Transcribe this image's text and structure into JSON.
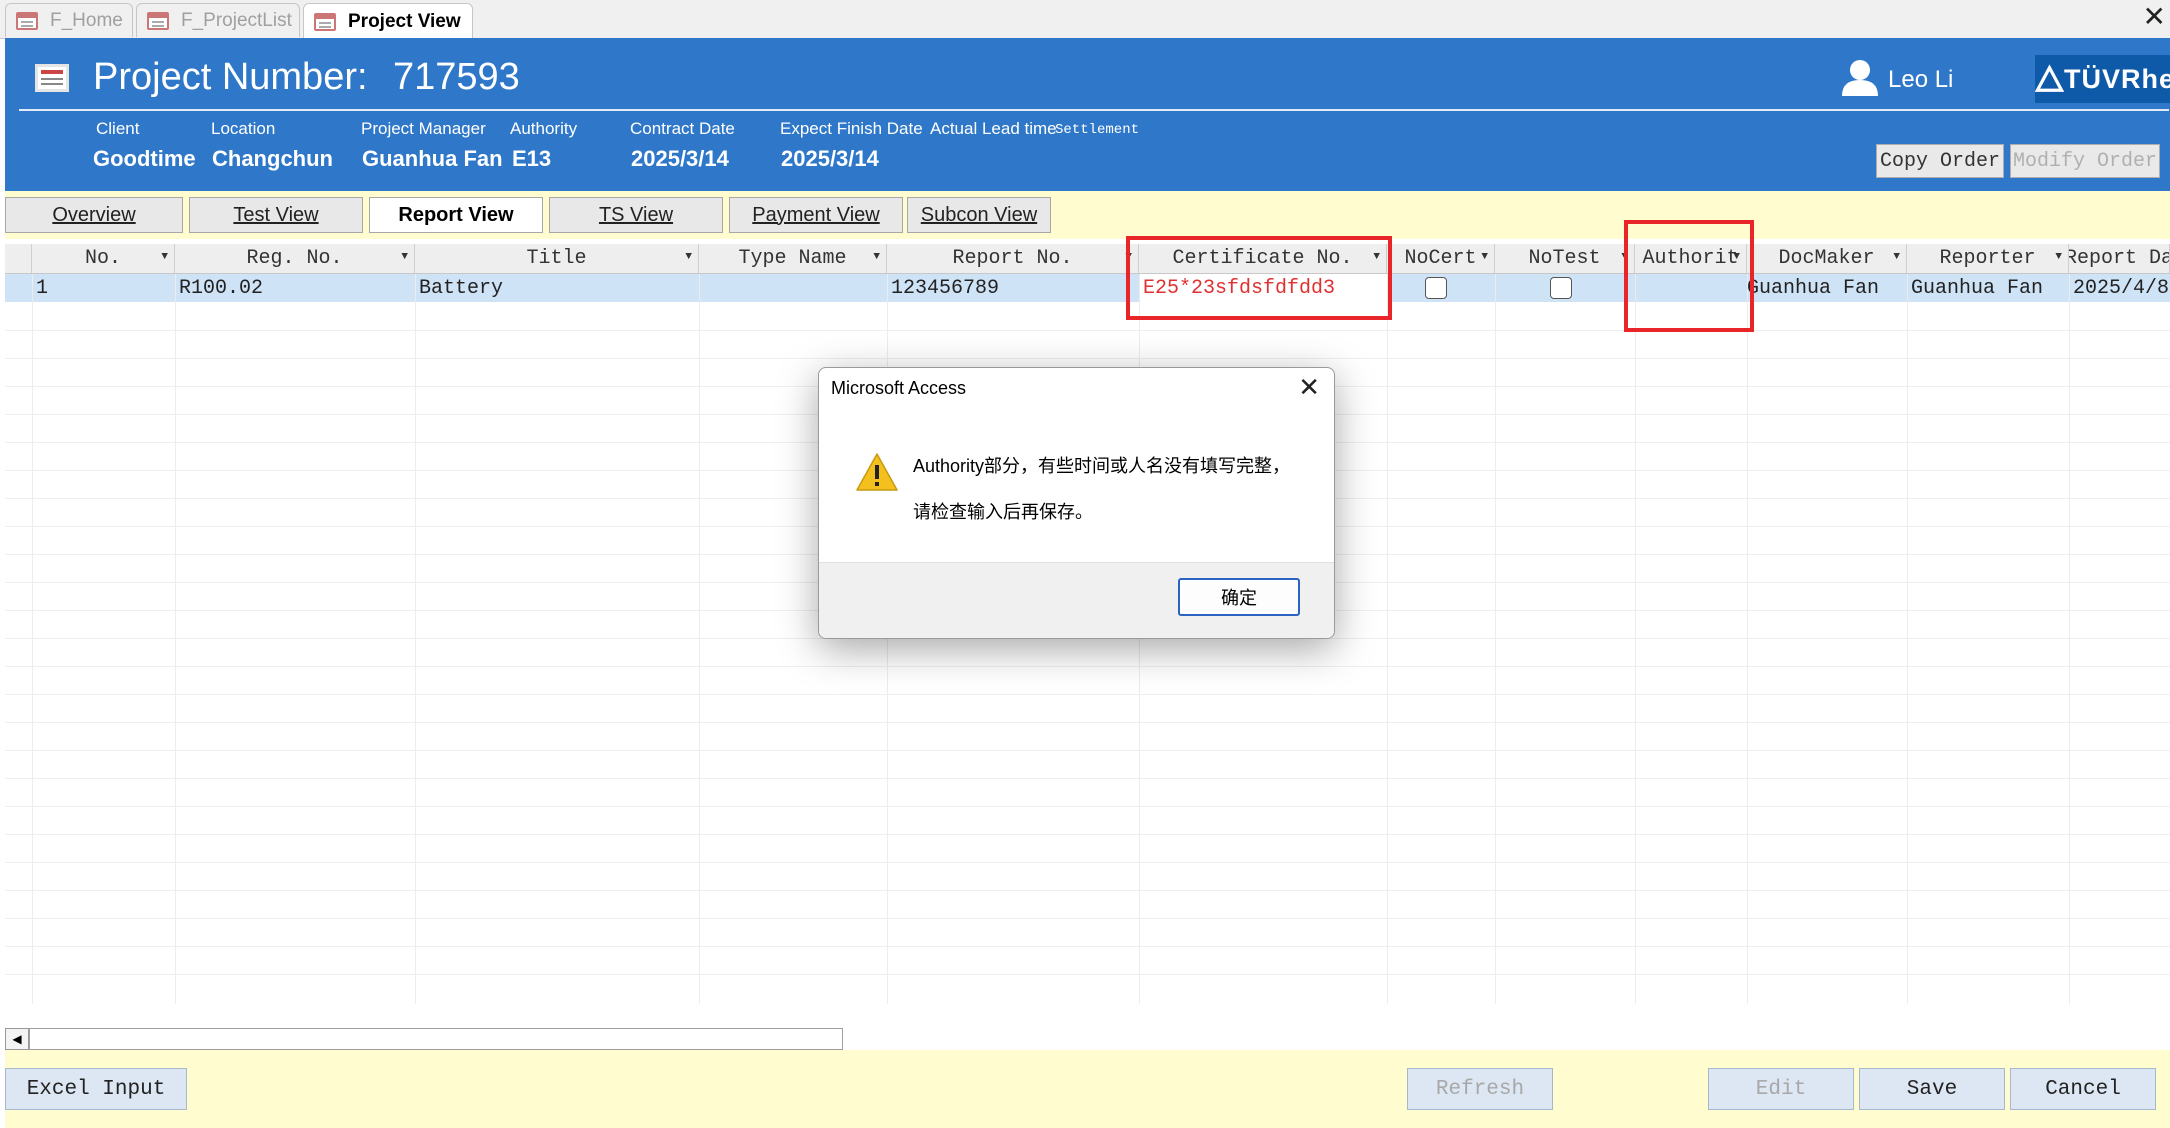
{
  "doc_tabs": [
    {
      "label": "F_Home",
      "active": false
    },
    {
      "label": "F_ProjectList",
      "active": false
    },
    {
      "label": "Project View",
      "active": true
    }
  ],
  "header": {
    "project_label": "Project Number:",
    "project_number": "717593",
    "user_name": "Leo Li",
    "logo_text": "TÜVRhe",
    "fields": [
      {
        "label": "Client",
        "value": "Goodtime"
      },
      {
        "label": "Location",
        "value": "Changchun"
      },
      {
        "label": "Project Manager",
        "value": "Guanhua Fan"
      },
      {
        "label": "Authority",
        "value": "E13"
      },
      {
        "label": "Contract Date",
        "value": "2025/3/14"
      },
      {
        "label": "Expect Finish Date",
        "value": "2025/3/14"
      },
      {
        "label": "Actual Lead time",
        "value": ""
      },
      {
        "label": "Settlement",
        "value": ""
      }
    ],
    "copy_order": "Copy Order",
    "modify_order": "Modify Order"
  },
  "view_tabs": [
    {
      "label": "Overview",
      "active": false
    },
    {
      "label": "Test View",
      "active": false
    },
    {
      "label": "Report View",
      "active": true
    },
    {
      "label": "TS View",
      "active": false
    },
    {
      "label": "Payment View",
      "active": false
    },
    {
      "label": "Subcon View",
      "active": false
    }
  ],
  "grid": {
    "columns": [
      "No.",
      "Reg. No.",
      "Title",
      "Type Name",
      "Report No.",
      "Certificate No.",
      "NoCert",
      "NoTest",
      "Authorit",
      "DocMaker",
      "Reporter",
      "Report Da"
    ],
    "rows": [
      {
        "no": "1",
        "reg_no": "R100.02",
        "title": "Battery",
        "type_name": "",
        "report_no": "123456789",
        "certificate_no": "E25*23sfdsfdfdd3",
        "no_cert": false,
        "no_test": false,
        "authority": "",
        "doc_maker": "Guanhua Fan",
        "reporter": "Guanhua Fan",
        "report_date": "2025/4/8"
      }
    ]
  },
  "footer": {
    "excel_input": "Excel Input",
    "refresh": "Refresh",
    "edit": "Edit",
    "save": "Save",
    "cancel": "Cancel"
  },
  "dialog": {
    "title": "Microsoft Access",
    "message_line1": "Authority部分，有些时间或人名没有填写完整，",
    "message_line2": "请检查输入后再保存。",
    "ok": "确定"
  },
  "colors": {
    "header_blue": "#2f78c9",
    "band_yellow": "#fffdd0",
    "highlight_red": "#e8262a",
    "selected_row": "#cfe3f7"
  }
}
